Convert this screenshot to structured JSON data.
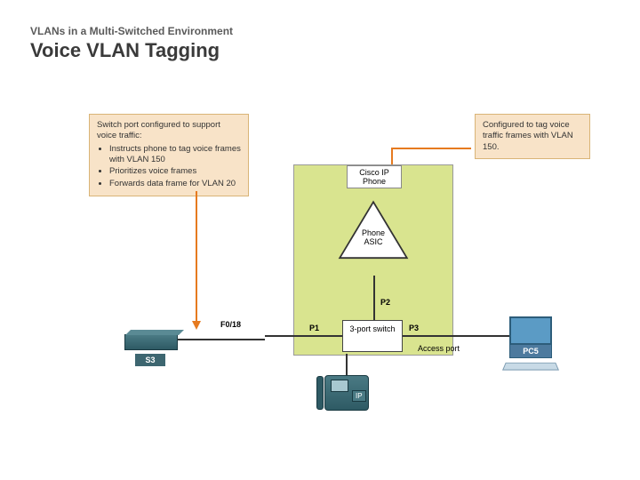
{
  "header": {
    "subtitle": "VLANs in a Multi-Switched Environment",
    "title": "Voice VLAN Tagging"
  },
  "callouts": {
    "left": {
      "title": "Switch port configured to support voice traffic:",
      "items": [
        "Instructs phone to tag voice frames with VLAN 150",
        "Prioritizes voice frames",
        "Forwards data frame for VLAN 20"
      ]
    },
    "right": {
      "text": "Configured to tag voice traffic frames with VLAN 150."
    }
  },
  "diagram": {
    "ip_phone_box": "Cisco IP Phone",
    "phone_asic": "Phone ASIC",
    "switch3": "3-port switch",
    "ports": {
      "p1": "P1",
      "p2": "P2",
      "p3": "P3"
    },
    "access_port": "Access port",
    "switch_port": "F0/18",
    "switch_s3": "S3",
    "pc5": "PC5",
    "ip_label": "IP"
  },
  "colors": {
    "callout_bg": "#f8e3c8",
    "ip_phone_box": "#d9e48f",
    "arrow": "#e67a1f",
    "device": "#3d6670",
    "pc": "#5b9bc5"
  }
}
